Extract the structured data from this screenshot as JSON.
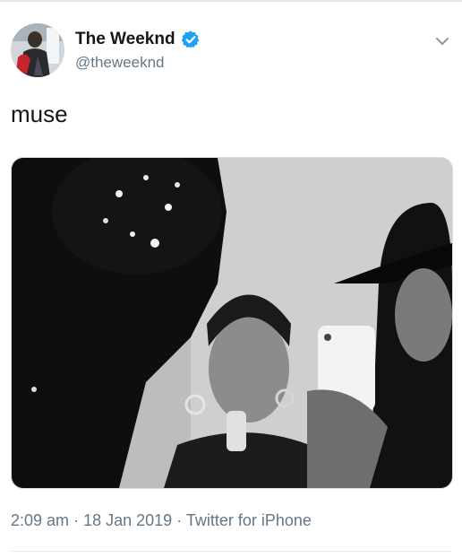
{
  "tweet": {
    "author": {
      "display_name": "The Weeknd",
      "handle": "@theweeknd",
      "verified": true,
      "avatar_icon": "profile-photo"
    },
    "text": "muse",
    "media": {
      "type": "photo",
      "style": "black-and-white"
    },
    "meta": {
      "time": "2:09 am",
      "separator": "·",
      "date": "18 Jan 2019",
      "source": "Twitter for iPhone"
    },
    "menu_icon": "chevron-down-icon"
  },
  "colors": {
    "verified_badge": "#1da1f2",
    "secondary_text": "#657786",
    "divider": "#e1e8ed"
  }
}
